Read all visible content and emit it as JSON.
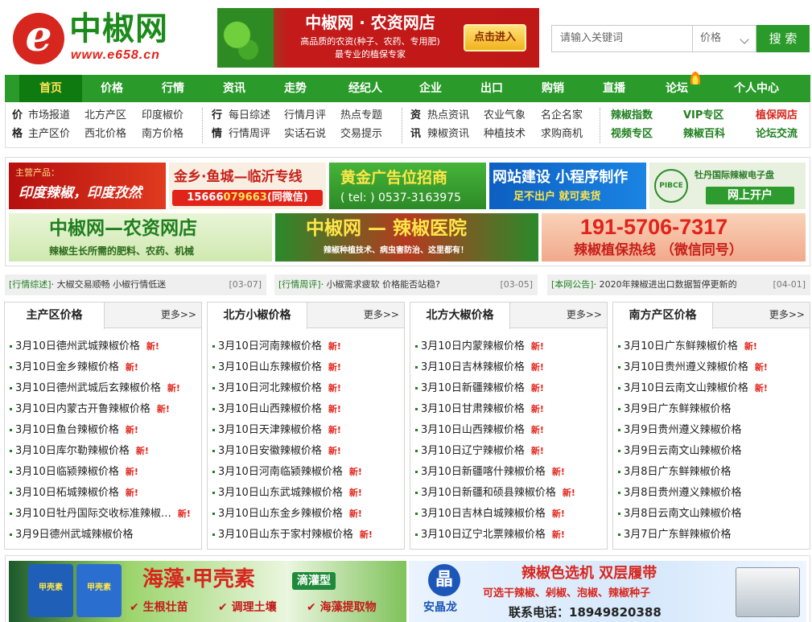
{
  "header": {
    "logo_letter": "e",
    "logo_name": "中椒网",
    "logo_url": "www.e658.cn",
    "banner": {
      "title": "中椒网 · 农资网店",
      "line1": "高品质的农资(种子、农药、专用肥)",
      "line2": "最专业的植保专家",
      "button": "点击进入"
    },
    "search": {
      "placeholder": "请输入关键词",
      "select": "价格",
      "button": "搜 索"
    }
  },
  "nav": {
    "items": [
      "首页",
      "价格",
      "行情",
      "资讯",
      "走势",
      "经纪人",
      "企业",
      "出口",
      "购销",
      "直播",
      "论坛",
      "个人中心"
    ],
    "active": "首页"
  },
  "subnav": {
    "groups": [
      {
        "label": [
          "价",
          "格"
        ],
        "row1": [
          "市场报道",
          "北方产区",
          "印度椒价"
        ],
        "row2": [
          "主产区价",
          "西北价格",
          "南方价格"
        ]
      },
      {
        "label": [
          "行",
          "情"
        ],
        "row1": [
          "每日综述",
          "行情月评",
          "热点专题"
        ],
        "row2": [
          "行情周评",
          "实话石说",
          "交易提示"
        ]
      },
      {
        "label": [
          "资",
          "讯"
        ],
        "row1": [
          "热点资讯",
          "农业气象",
          "名企名家"
        ],
        "row2": [
          "辣椒资讯",
          "种植技术",
          "求购商机"
        ]
      }
    ],
    "extra": {
      "row1": [
        "辣椒指数",
        "VIP专区",
        "植保网店"
      ],
      "row2": [
        "视频专区",
        "辣椒百科",
        "论坛交流"
      ]
    }
  },
  "ads": {
    "ad1": {
      "small": "主营产品：",
      "big": "印度辣椒，印度孜然"
    },
    "ad2": {
      "title": "金乡·鱼城—临沂专线",
      "phone_a": "15666",
      "phone_b": "079663",
      "suffix": "(同微信)"
    },
    "ad3": {
      "title": "黄金广告位招商",
      "tel": "( tel: ) 0537-3163975"
    },
    "ad4": {
      "title": "网站建设 小程序制作",
      "sub": "足不出户 就可卖货"
    },
    "ad5": {
      "logo": "PIBCE",
      "title": "牡丹国际辣椒电子盘",
      "sub": "网上开户"
    },
    "ad6": {
      "title": "中椒网—农资网店",
      "sub": "辣椒生长所需的肥料、农药、机械"
    },
    "ad7": {
      "title": "中椒网 — 辣椒医院",
      "sub": "辣椒种植技术、病虫害防治、这里都有！"
    },
    "ad8": {
      "phone": "191-5706-7317",
      "sub": "辣椒植保热线 （微信同号）"
    }
  },
  "news": [
    {
      "tag": "[行情综述]",
      "title": "· 大椒交易顺畅 小椒行情低迷",
      "date": "[03-07]"
    },
    {
      "tag": "[行情周评]",
      "title": "· 小椒需求疲软 价格能否站稳?",
      "date": "[03-05]"
    },
    {
      "tag": "[本网公告]",
      "title": "· 2020年辣椒进出口数据暂停更新的",
      "date": "[04-01]"
    }
  ],
  "boxes": [
    {
      "title": "主产区价格",
      "more": "更多>>",
      "items": [
        {
          "text": "3月10日德州武城辣椒价格",
          "new": true
        },
        {
          "text": "3月10日金乡辣椒价格",
          "new": true
        },
        {
          "text": "3月10日德州武城后玄辣椒价格",
          "new": true
        },
        {
          "text": "3月10日内蒙古开鲁辣椒价格",
          "new": true
        },
        {
          "text": "3月10日鱼台辣椒价格",
          "new": true
        },
        {
          "text": "3月10日库尔勒辣椒价格",
          "new": true
        },
        {
          "text": "3月10日临颍辣椒价格",
          "new": true
        },
        {
          "text": "3月10日柘城辣椒价格",
          "new": true
        },
        {
          "text": "3月10日牡丹国际交收标准辣椒…",
          "new": true
        },
        {
          "text": "3月9日德州武城辣椒价格",
          "new": false
        }
      ]
    },
    {
      "title": "北方小椒价格",
      "more": "更多>>",
      "items": [
        {
          "text": "3月10日河南辣椒价格",
          "new": true
        },
        {
          "text": "3月10日山东辣椒价格",
          "new": true
        },
        {
          "text": "3月10日河北辣椒价格",
          "new": true
        },
        {
          "text": "3月10日山西辣椒价格",
          "new": true
        },
        {
          "text": "3月10日天津辣椒价格",
          "new": true
        },
        {
          "text": "3月10日安徽辣椒价格",
          "new": true
        },
        {
          "text": "3月10日河南临颍辣椒价格",
          "new": true
        },
        {
          "text": "3月10日山东武城辣椒价格",
          "new": true
        },
        {
          "text": "3月10日山东金乡辣椒价格",
          "new": true
        },
        {
          "text": "3月10日山东于家村辣椒价格",
          "new": true
        }
      ]
    },
    {
      "title": "北方大椒价格",
      "more": "更多>>",
      "items": [
        {
          "text": "3月10日内蒙辣椒价格",
          "new": true
        },
        {
          "text": "3月10日吉林辣椒价格",
          "new": true
        },
        {
          "text": "3月10日新疆辣椒价格",
          "new": true
        },
        {
          "text": "3月10日甘肃辣椒价格",
          "new": true
        },
        {
          "text": "3月10日山西辣椒价格",
          "new": true
        },
        {
          "text": "3月10日辽宁辣椒价格",
          "new": true
        },
        {
          "text": "3月10日新疆喀什辣椒价格",
          "new": true
        },
        {
          "text": "3月10日新疆和硕县辣椒价格",
          "new": true
        },
        {
          "text": "3月10日吉林白城辣椒价格",
          "new": true
        },
        {
          "text": "3月10日辽宁北票辣椒价格",
          "new": true
        }
      ]
    },
    {
      "title": "南方产区价格",
      "more": "更多>>",
      "items": [
        {
          "text": "3月10日广东鲜辣椒价格",
          "new": true
        },
        {
          "text": "3月10日贵州遵义辣椒价格",
          "new": true
        },
        {
          "text": "3月10日云南文山辣椒价格",
          "new": true
        },
        {
          "text": "3月9日广东鲜辣椒价格",
          "new": false
        },
        {
          "text": "3月9日贵州遵义辣椒价格",
          "new": false
        },
        {
          "text": "3月9日云南文山辣椒价格",
          "new": false
        },
        {
          "text": "3月8日广东鲜辣椒价格",
          "new": false
        },
        {
          "text": "3月8日贵州遵义辣椒价格",
          "new": false
        },
        {
          "text": "3月8日云南文山辣椒价格",
          "new": false
        },
        {
          "text": "3月7日广东鲜辣椒价格",
          "new": false
        }
      ]
    }
  ],
  "new_label": "新!",
  "bottom_ads": {
    "left": {
      "bucket1": "甲壳素",
      "bucket2": "甲壳素",
      "title": "海藻·甲壳素",
      "tag": "滴灌型",
      "f1": "生根壮苗",
      "f2": "调理土壤",
      "f3": "海藻提取物"
    },
    "right": {
      "logo": "晶",
      "brand": "安晶龙",
      "title": "辣椒色选机  双层履带",
      "sub": "可选干辣椒、剁椒、泡椒、辣椒种子",
      "contact": "联系电话：18949820388"
    }
  },
  "colors": {
    "brand_green": "#2a9b2a",
    "brand_red": "#d7261e",
    "new_red": "#e2231a"
  }
}
